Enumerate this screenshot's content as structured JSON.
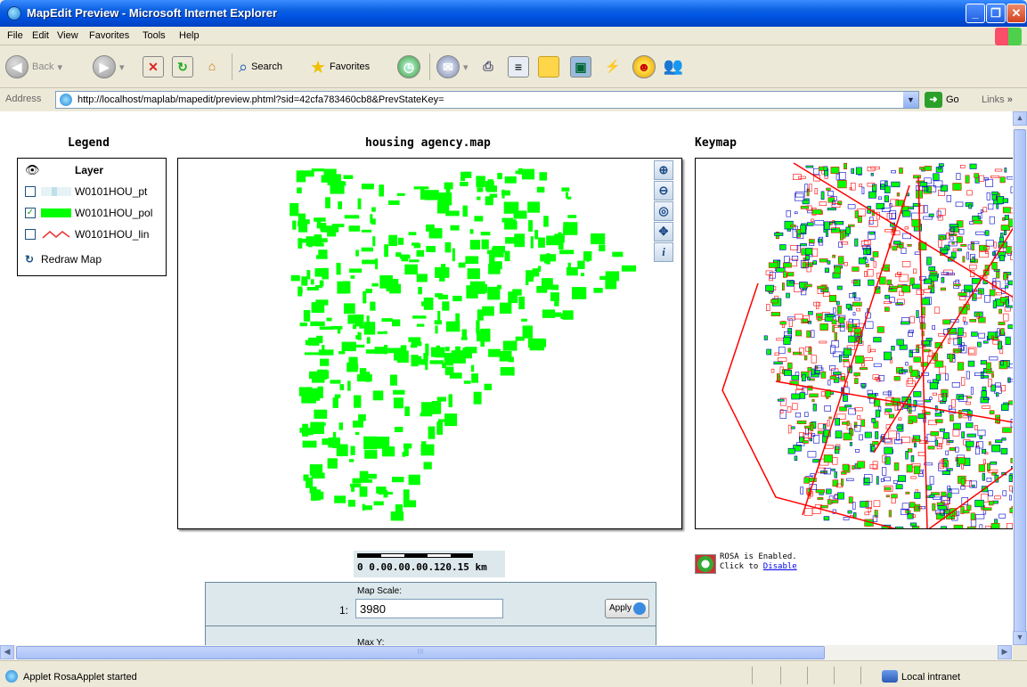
{
  "window": {
    "title": "MapEdit Preview - Microsoft Internet Explorer"
  },
  "menu": [
    "File",
    "Edit",
    "View",
    "Favorites",
    "Tools",
    "Help"
  ],
  "toolbar": {
    "back": "Back",
    "search": "Search",
    "favorites": "Favorites"
  },
  "address": {
    "label": "Address",
    "url": "http://localhost/maplab/mapedit/preview.phtml?sid=42cfa783460cb8&PrevStateKey=",
    "go": "Go",
    "links": "Links"
  },
  "legend": {
    "heading": "Legend",
    "column": "Layer",
    "layers": [
      {
        "name": "W0101HOU_pt",
        "checked": false
      },
      {
        "name": "W0101HOU_pol",
        "checked": true
      },
      {
        "name": "W0101HOU_lin",
        "checked": false
      }
    ],
    "redraw": "Redraw Map"
  },
  "map": {
    "title": "housing agency.map",
    "tools": [
      "zoom-in",
      "zoom-out",
      "zoom-full",
      "pan",
      "info"
    ]
  },
  "keymap": {
    "title": "Keymap"
  },
  "scalebar": {
    "text": "0 0.00.00.00.120.15 km"
  },
  "rosa": {
    "line1": "ROSA is Enabled.",
    "line2": "Click to ",
    "link": "Disable"
  },
  "scale_panel": {
    "label": "Map Scale:",
    "prefix": "1:",
    "value": "3980",
    "apply": "Apply",
    "next_label": "Max Y:"
  },
  "status": {
    "text": "Applet RosaApplet started",
    "zone": "Local intranet"
  },
  "colors": {
    "parcel": "#00ff00",
    "road": "#ff0000",
    "parcel_outline": "#0000cc"
  }
}
